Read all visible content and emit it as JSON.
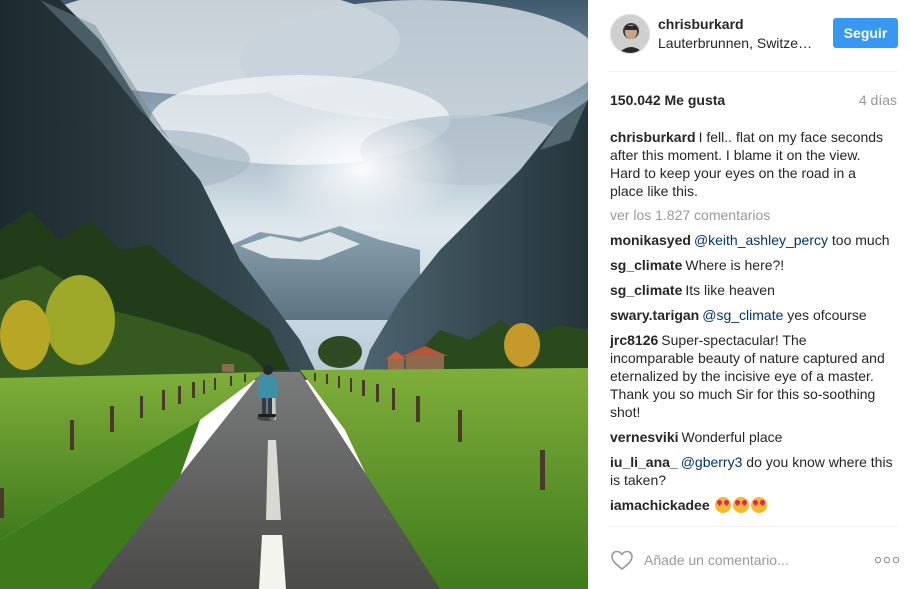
{
  "post": {
    "username": "chrisburkard",
    "location": "Lauterbrunnen, Switzerland",
    "follow_label": "Seguir",
    "likes": "150.042 Me gusta",
    "time_ago": "4 días",
    "caption": {
      "username": "chrisburkard",
      "text": "I fell.. flat on my face seconds after this moment. I blame it on the view. Hard to keep your eyes on the road in a place like this."
    },
    "view_all_comments": "ver los 1.827 comentarios",
    "comments": [
      {
        "username": "monikasyed",
        "mention": "@keith_ashley_percy",
        "text": " too much"
      },
      {
        "username": "sg_climate",
        "text": "Where is here?!"
      },
      {
        "username": "sg_climate",
        "text": "Its like heaven"
      },
      {
        "username": "swary.tarigan",
        "mention": "@sg_climate",
        "text": " yes ofcourse"
      },
      {
        "username": "jrc8126",
        "text": "Super-spectacular! The incomparable beauty of nature captured and eternalized by the incisive eye of a master. Thank you so much Sir for this so-soothing shot!"
      },
      {
        "username": "vernesviki",
        "text": "Wonderful place"
      },
      {
        "username": "iu_li_ana_",
        "mention": "@gberry3",
        "text": " do you know where this is taken?"
      },
      {
        "username": "iamachickadee",
        "text": ""
      }
    ],
    "comment_placeholder": "Añade un comentario..."
  },
  "icons": {
    "avatar": "profile-photo",
    "like": "heart-outline-icon",
    "more": "ellipsis-icon",
    "emoji": "heart-eyes-emoji"
  },
  "colors": {
    "accent": "#3897f0",
    "text": "#262626",
    "muted": "#999999",
    "mention": "#003569",
    "divider": "#efefef"
  }
}
